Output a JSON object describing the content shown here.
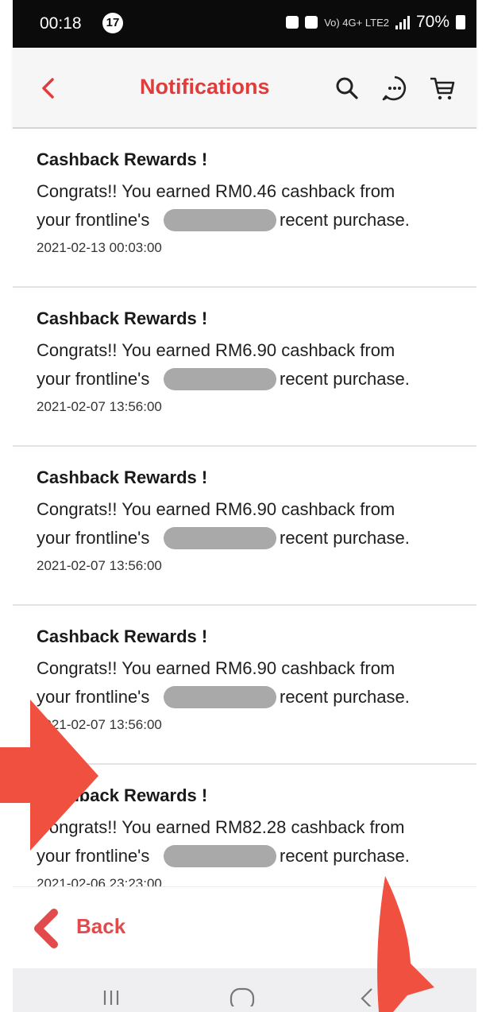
{
  "status_bar": {
    "time": "00:18",
    "badge": "17",
    "network": "Vo) 4G+ LTE2",
    "battery": "70%"
  },
  "app_bar": {
    "title": "Notifications",
    "back_icon": "chevron-left-icon",
    "icons": [
      "search-icon",
      "chat-bubble-icon",
      "cart-icon"
    ],
    "accent_color": "#e03c3c"
  },
  "notifications": [
    {
      "title": "Cashback Rewards !",
      "line1": "Congrats!! You earned RM0.46 cashback from",
      "line2_start": "your frontline's",
      "line2_end": "recent purchase.",
      "date": "2021-02-13 00:03:00"
    },
    {
      "title": "Cashback Rewards !",
      "line1": "Congrats!! You earned RM6.90 cashback from",
      "line2_start": "your frontline's",
      "line2_end": "recent purchase.",
      "date": "2021-02-07 13:56:00"
    },
    {
      "title": "Cashback Rewards !",
      "line1": "Congrats!! You earned RM6.90 cashback from",
      "line2_start": "your frontline's",
      "line2_end": "recent purchase.",
      "date": "2021-02-07 13:56:00"
    },
    {
      "title": "Cashback Rewards !",
      "line1": "Congrats!! You earned RM6.90 cashback from",
      "line2_start": "your frontline's",
      "line2_end": "recent purchase.",
      "date": "2021-02-07 13:56:00"
    },
    {
      "title": "Cashback Rewards !",
      "line1": "Congrats!! You earned RM82.28 cashback from",
      "line2_start": "your frontline's",
      "line2_end": "recent purchase.",
      "date": "2021-02-06 23:23:00"
    }
  ],
  "footer": {
    "back_label": "Back",
    "back_icon": "chevron-left-icon"
  },
  "system_nav": {
    "buttons": [
      "recents-icon",
      "home-icon",
      "back-icon"
    ]
  },
  "annotations": {
    "arrow_color": "#f05040",
    "arrows": [
      "annotation-arrow-right",
      "annotation-arrow-up"
    ]
  }
}
